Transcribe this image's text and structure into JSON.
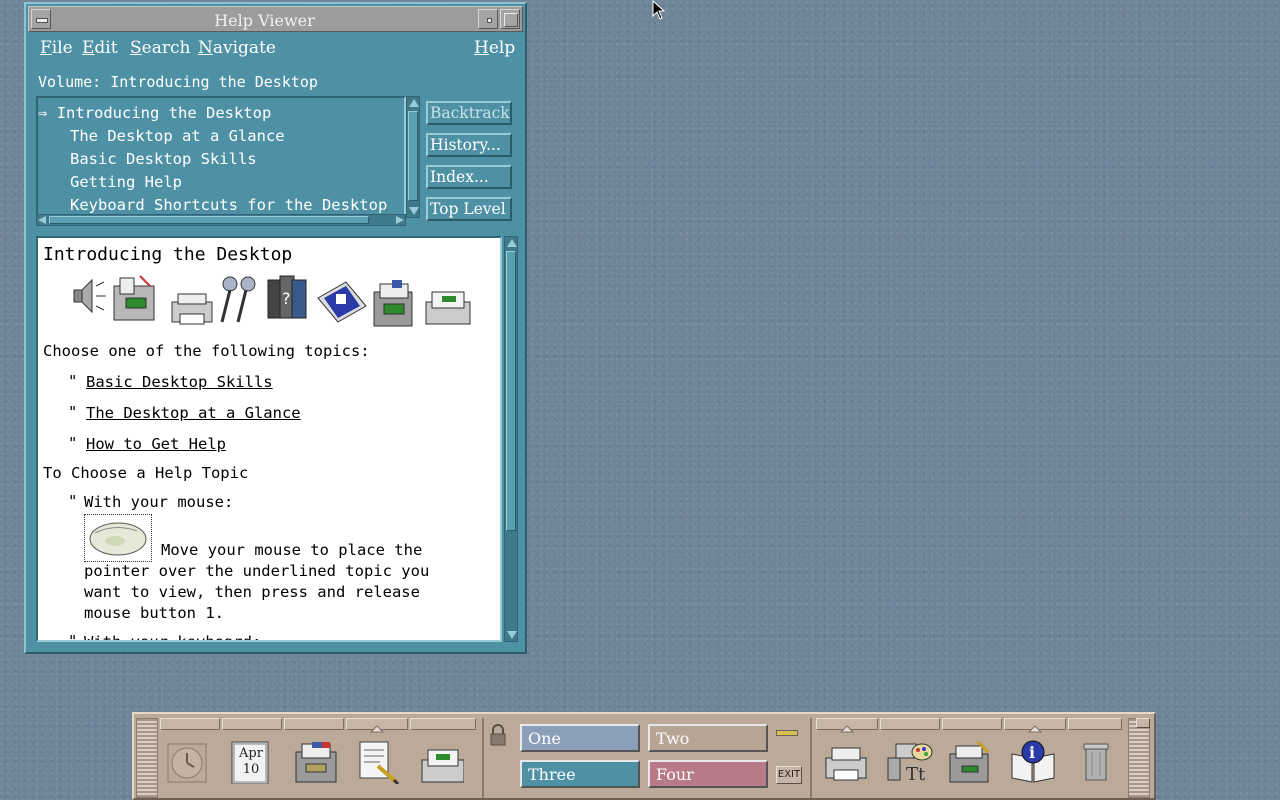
{
  "window": {
    "title": "Help Viewer",
    "menus": {
      "file": {
        "mnemonic": "F",
        "rest": "ile"
      },
      "edit": {
        "mnemonic": "E",
        "rest": "dit"
      },
      "search": {
        "mnemonic": "S",
        "rest": "earch"
      },
      "navigate": {
        "mnemonic": "N",
        "rest": "avigate"
      },
      "help": {
        "mnemonic": "H",
        "rest": "elp"
      }
    },
    "volume_label": "Volume:",
    "volume_name": "Introducing the Desktop",
    "toc": {
      "marker": "⇒",
      "items": [
        "Introducing the Desktop",
        "The Desktop at a Glance",
        "Basic Desktop Skills",
        "Getting Help",
        "Keyboard Shortcuts for the Desktop"
      ]
    },
    "buttons": {
      "backtrack": "Backtrack",
      "history": "History...",
      "index": "Index...",
      "top_level": "Top Level"
    }
  },
  "content": {
    "heading": "Introducing the Desktop",
    "choose_prompt": "Choose one of the following topics:",
    "bullet": "\"",
    "topic_links": [
      "Basic Desktop Skills",
      "The Desktop at a Glance",
      "How to Get Help"
    ],
    "section_heading": "To Choose a Help Topic",
    "mouse_label": "With your mouse:",
    "mouse_instructions": [
      "Move your mouse to place the",
      "pointer over the underlined topic you",
      "want to view, then press and release",
      "mouse button 1."
    ],
    "keyboard_label": "With your keyboard:"
  },
  "front_panel": {
    "calendar": {
      "month": "Apr",
      "day": "10"
    },
    "workspaces": [
      {
        "name": "One",
        "color": "#8ba0b8"
      },
      {
        "name": "Two",
        "color": "#b6a494"
      },
      {
        "name": "Three",
        "color": "#4f91a4"
      },
      {
        "name": "Four",
        "color": "#b87a87"
      }
    ],
    "exit_label": "EXIT",
    "icons": [
      "clock-icon",
      "calendar-icon",
      "file-manager-icon",
      "text-editor-icon",
      "mailer-icon",
      "lock-icon",
      "printer-icon",
      "style-manager-icon",
      "application-manager-icon",
      "help-manager-icon",
      "trash-icon"
    ]
  },
  "colors": {
    "window_bg": "#4f91a4",
    "desktop_bg": "#6f8499",
    "panel_bg": "#bba99a",
    "title_bar": "#9c9c9c"
  }
}
